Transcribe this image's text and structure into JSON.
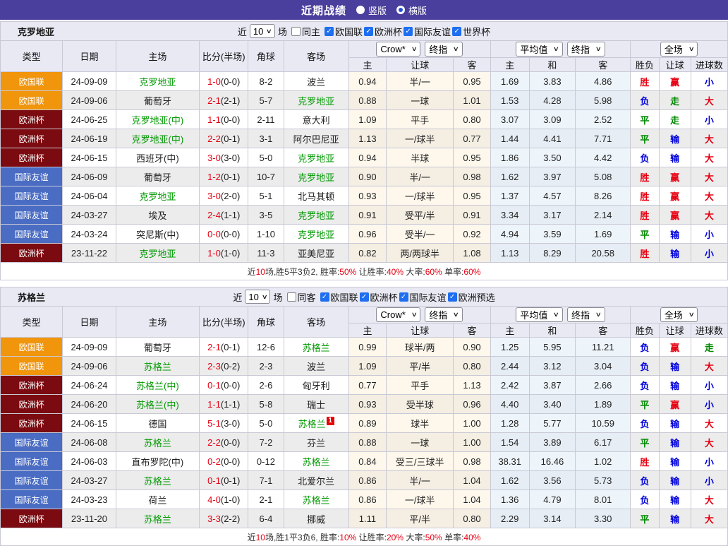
{
  "topbar": {
    "title": "近期战绩",
    "vertical_label": "竖版",
    "horizontal_label": "横版"
  },
  "labels": {
    "near": "近",
    "games": "场"
  },
  "columns": [
    "类型",
    "日期",
    "主场",
    "比分(半场)",
    "角球",
    "客场"
  ],
  "sub_columns": [
    "主",
    "让球",
    "客",
    "主",
    "和",
    "客",
    "胜负",
    "让球",
    "进球数"
  ],
  "selects": {
    "company": "Crow*",
    "final1": "终指",
    "average": "平均值",
    "final2": "终指",
    "scope": "全场"
  },
  "league_colors": {
    "欧国联": "#f0950c",
    "欧洲杯": "#7b0b10",
    "国际友谊": "#4a6cc3"
  },
  "result_colors": {
    "R": "#e60012",
    "B": "#0000dd",
    "G": "#008800"
  },
  "sections": [
    {
      "team": "克罗地亚",
      "count": "10",
      "same_label": "同主",
      "leagues": [
        "欧国联",
        "欧洲杯",
        "国际友谊",
        "世界杯"
      ],
      "rows": [
        {
          "lg": "欧国联",
          "date": "24-09-09",
          "home": "克罗地亚",
          "hG": true,
          "score": "1-0",
          "half": "(0-0)",
          "cor": "8-2",
          "away": "波兰",
          "aG": false,
          "o": [
            "0.94",
            "半/一",
            "0.95"
          ],
          "a": [
            "1.69",
            "3.83",
            "4.86"
          ],
          "res": [
            [
              "胜",
              "R"
            ],
            [
              "赢",
              "R"
            ],
            [
              "小",
              "B"
            ]
          ]
        },
        {
          "lg": "欧国联",
          "date": "24-09-06",
          "home": "葡萄牙",
          "hG": false,
          "score": "2-1",
          "half": "(2-1)",
          "cor": "5-7",
          "away": "克罗地亚",
          "aG": true,
          "o": [
            "0.88",
            "一球",
            "1.01"
          ],
          "a": [
            "1.53",
            "4.28",
            "5.98"
          ],
          "res": [
            [
              "负",
              "B"
            ],
            [
              "走",
              "G"
            ],
            [
              "大",
              "R"
            ]
          ]
        },
        {
          "lg": "欧洲杯",
          "date": "24-06-25",
          "home": "克罗地亚(中)",
          "hG": true,
          "score": "1-1",
          "half": "(0-0)",
          "cor": "2-11",
          "away": "意大利",
          "aG": false,
          "o": [
            "1.09",
            "平手",
            "0.80"
          ],
          "a": [
            "3.07",
            "3.09",
            "2.52"
          ],
          "res": [
            [
              "平",
              "G"
            ],
            [
              "走",
              "G"
            ],
            [
              "小",
              "B"
            ]
          ]
        },
        {
          "lg": "欧洲杯",
          "date": "24-06-19",
          "home": "克罗地亚(中)",
          "hG": true,
          "score": "2-2",
          "half": "(0-1)",
          "cor": "3-1",
          "away": "阿尔巴尼亚",
          "aG": false,
          "o": [
            "1.13",
            "一/球半",
            "0.77"
          ],
          "a": [
            "1.44",
            "4.41",
            "7.71"
          ],
          "res": [
            [
              "平",
              "G"
            ],
            [
              "输",
              "B"
            ],
            [
              "大",
              "R"
            ]
          ]
        },
        {
          "lg": "欧洲杯",
          "date": "24-06-15",
          "home": "西班牙(中)",
          "hG": false,
          "score": "3-0",
          "half": "(3-0)",
          "cor": "5-0",
          "away": "克罗地亚",
          "aG": true,
          "o": [
            "0.94",
            "半球",
            "0.95"
          ],
          "a": [
            "1.86",
            "3.50",
            "4.42"
          ],
          "res": [
            [
              "负",
              "B"
            ],
            [
              "输",
              "B"
            ],
            [
              "大",
              "R"
            ]
          ]
        },
        {
          "lg": "国际友谊",
          "date": "24-06-09",
          "home": "葡萄牙",
          "hG": false,
          "score": "1-2",
          "half": "(0-1)",
          "cor": "10-7",
          "away": "克罗地亚",
          "aG": true,
          "o": [
            "0.90",
            "半/一",
            "0.98"
          ],
          "a": [
            "1.62",
            "3.97",
            "5.08"
          ],
          "res": [
            [
              "胜",
              "R"
            ],
            [
              "赢",
              "R"
            ],
            [
              "大",
              "R"
            ]
          ]
        },
        {
          "lg": "国际友谊",
          "date": "24-06-04",
          "home": "克罗地亚",
          "hG": true,
          "score": "3-0",
          "half": "(2-0)",
          "cor": "5-1",
          "away": "北马其顿",
          "aG": false,
          "o": [
            "0.93",
            "一/球半",
            "0.95"
          ],
          "a": [
            "1.37",
            "4.57",
            "8.26"
          ],
          "res": [
            [
              "胜",
              "R"
            ],
            [
              "赢",
              "R"
            ],
            [
              "大",
              "R"
            ]
          ]
        },
        {
          "lg": "国际友谊",
          "date": "24-03-27",
          "home": "埃及",
          "hG": false,
          "score": "2-4",
          "half": "(1-1)",
          "cor": "3-5",
          "away": "克罗地亚",
          "aG": true,
          "o": [
            "0.91",
            "受平/半",
            "0.91"
          ],
          "a": [
            "3.34",
            "3.17",
            "2.14"
          ],
          "res": [
            [
              "胜",
              "R"
            ],
            [
              "赢",
              "R"
            ],
            [
              "大",
              "R"
            ]
          ]
        },
        {
          "lg": "国际友谊",
          "date": "24-03-24",
          "home": "突尼斯(中)",
          "hG": false,
          "score": "0-0",
          "half": "(0-0)",
          "cor": "1-10",
          "away": "克罗地亚",
          "aG": true,
          "o": [
            "0.96",
            "受半/一",
            "0.92"
          ],
          "a": [
            "4.94",
            "3.59",
            "1.69"
          ],
          "res": [
            [
              "平",
              "G"
            ],
            [
              "输",
              "B"
            ],
            [
              "小",
              "B"
            ]
          ]
        },
        {
          "lg": "欧洲杯",
          "date": "23-11-22",
          "home": "克罗地亚",
          "hG": true,
          "score": "1-0",
          "half": "(1-0)",
          "cor": "11-3",
          "away": "亚美尼亚",
          "aG": false,
          "o": [
            "0.82",
            "两/两球半",
            "1.08"
          ],
          "a": [
            "1.13",
            "8.29",
            "20.58"
          ],
          "res": [
            [
              "胜",
              "R"
            ],
            [
              "输",
              "B"
            ],
            [
              "小",
              "B"
            ]
          ]
        }
      ],
      "summary": [
        {
          "t": "近"
        },
        {
          "t": "10",
          "r": true
        },
        {
          "t": "场,胜5平3负2, 胜率:"
        },
        {
          "t": "50%",
          "r": true
        },
        {
          "t": " 让胜率:"
        },
        {
          "t": "40%",
          "r": true
        },
        {
          "t": " 大率:"
        },
        {
          "t": "60%",
          "r": true
        },
        {
          "t": " 单率:"
        },
        {
          "t": "60%",
          "r": true
        }
      ]
    },
    {
      "team": "苏格兰",
      "count": "10",
      "same_label": "同客",
      "leagues": [
        "欧国联",
        "欧洲杯",
        "国际友谊",
        "欧洲预选"
      ],
      "rows": [
        {
          "lg": "欧国联",
          "date": "24-09-09",
          "home": "葡萄牙",
          "hG": false,
          "score": "2-1",
          "half": "(0-1)",
          "cor": "12-6",
          "away": "苏格兰",
          "aG": true,
          "o": [
            "0.99",
            "球半/两",
            "0.90"
          ],
          "a": [
            "1.25",
            "5.95",
            "11.21"
          ],
          "res": [
            [
              "负",
              "B"
            ],
            [
              "赢",
              "R"
            ],
            [
              "走",
              "G"
            ]
          ]
        },
        {
          "lg": "欧国联",
          "date": "24-09-06",
          "home": "苏格兰",
          "hG": true,
          "score": "2-3",
          "half": "(0-2)",
          "cor": "2-3",
          "away": "波兰",
          "aG": false,
          "o": [
            "1.09",
            "平/半",
            "0.80"
          ],
          "a": [
            "2.44",
            "3.12",
            "3.04"
          ],
          "res": [
            [
              "负",
              "B"
            ],
            [
              "输",
              "B"
            ],
            [
              "大",
              "R"
            ]
          ]
        },
        {
          "lg": "欧洲杯",
          "date": "24-06-24",
          "home": "苏格兰(中)",
          "hG": true,
          "score": "0-1",
          "half": "(0-0)",
          "cor": "2-6",
          "away": "匈牙利",
          "aG": false,
          "o": [
            "0.77",
            "平手",
            "1.13"
          ],
          "a": [
            "2.42",
            "3.87",
            "2.66"
          ],
          "res": [
            [
              "负",
              "B"
            ],
            [
              "输",
              "B"
            ],
            [
              "小",
              "B"
            ]
          ]
        },
        {
          "lg": "欧洲杯",
          "date": "24-06-20",
          "home": "苏格兰(中)",
          "hG": true,
          "score": "1-1",
          "half": "(1-1)",
          "cor": "5-8",
          "away": "瑞士",
          "aG": false,
          "o": [
            "0.93",
            "受半球",
            "0.96"
          ],
          "a": [
            "4.40",
            "3.40",
            "1.89"
          ],
          "res": [
            [
              "平",
              "G"
            ],
            [
              "赢",
              "R"
            ],
            [
              "小",
              "B"
            ]
          ]
        },
        {
          "lg": "欧洲杯",
          "date": "24-06-15",
          "home": "德国",
          "hG": false,
          "score": "5-1",
          "half": "(3-0)",
          "cor": "5-0",
          "away": "苏格兰",
          "aG": true,
          "arc": "1",
          "o": [
            "0.89",
            "球半",
            "1.00"
          ],
          "a": [
            "1.28",
            "5.77",
            "10.59"
          ],
          "res": [
            [
              "负",
              "B"
            ],
            [
              "输",
              "B"
            ],
            [
              "大",
              "R"
            ]
          ]
        },
        {
          "lg": "国际友谊",
          "date": "24-06-08",
          "home": "苏格兰",
          "hG": true,
          "score": "2-2",
          "half": "(0-0)",
          "cor": "7-2",
          "away": "芬兰",
          "aG": false,
          "o": [
            "0.88",
            "一球",
            "1.00"
          ],
          "a": [
            "1.54",
            "3.89",
            "6.17"
          ],
          "res": [
            [
              "平",
              "G"
            ],
            [
              "输",
              "B"
            ],
            [
              "大",
              "R"
            ]
          ]
        },
        {
          "lg": "国际友谊",
          "date": "24-06-03",
          "home": "直布罗陀(中)",
          "hG": false,
          "score": "0-2",
          "half": "(0-0)",
          "cor": "0-12",
          "away": "苏格兰",
          "aG": true,
          "o": [
            "0.84",
            "受三/三球半",
            "0.98"
          ],
          "a": [
            "38.31",
            "16.46",
            "1.02"
          ],
          "res": [
            [
              "胜",
              "R"
            ],
            [
              "输",
              "B"
            ],
            [
              "小",
              "B"
            ]
          ]
        },
        {
          "lg": "国际友谊",
          "date": "24-03-27",
          "home": "苏格兰",
          "hG": true,
          "score": "0-1",
          "half": "(0-1)",
          "cor": "7-1",
          "away": "北爱尔兰",
          "aG": false,
          "o": [
            "0.86",
            "半/一",
            "1.04"
          ],
          "a": [
            "1.62",
            "3.56",
            "5.73"
          ],
          "res": [
            [
              "负",
              "B"
            ],
            [
              "输",
              "B"
            ],
            [
              "小",
              "B"
            ]
          ]
        },
        {
          "lg": "国际友谊",
          "date": "24-03-23",
          "home": "荷兰",
          "hG": false,
          "score": "4-0",
          "half": "(1-0)",
          "cor": "2-1",
          "away": "苏格兰",
          "aG": true,
          "o": [
            "0.86",
            "一/球半",
            "1.04"
          ],
          "a": [
            "1.36",
            "4.79",
            "8.01"
          ],
          "res": [
            [
              "负",
              "B"
            ],
            [
              "输",
              "B"
            ],
            [
              "大",
              "R"
            ]
          ]
        },
        {
          "lg": "欧洲杯",
          "date": "23-11-20",
          "home": "苏格兰",
          "hG": true,
          "score": "3-3",
          "half": "(2-2)",
          "cor": "6-4",
          "away": "挪威",
          "aG": false,
          "o": [
            "1.11",
            "平/半",
            "0.80"
          ],
          "a": [
            "2.29",
            "3.14",
            "3.30"
          ],
          "res": [
            [
              "平",
              "G"
            ],
            [
              "输",
              "B"
            ],
            [
              "大",
              "R"
            ]
          ]
        }
      ],
      "summary": [
        {
          "t": "近"
        },
        {
          "t": "10",
          "r": true
        },
        {
          "t": "场,胜1平3负6, 胜率:"
        },
        {
          "t": "10%",
          "r": true
        },
        {
          "t": " 让胜率:"
        },
        {
          "t": "20%",
          "r": true
        },
        {
          "t": " 大率:"
        },
        {
          "t": "50%",
          "r": true
        },
        {
          "t": " 单率:"
        },
        {
          "t": "40%",
          "r": true
        }
      ]
    }
  ]
}
